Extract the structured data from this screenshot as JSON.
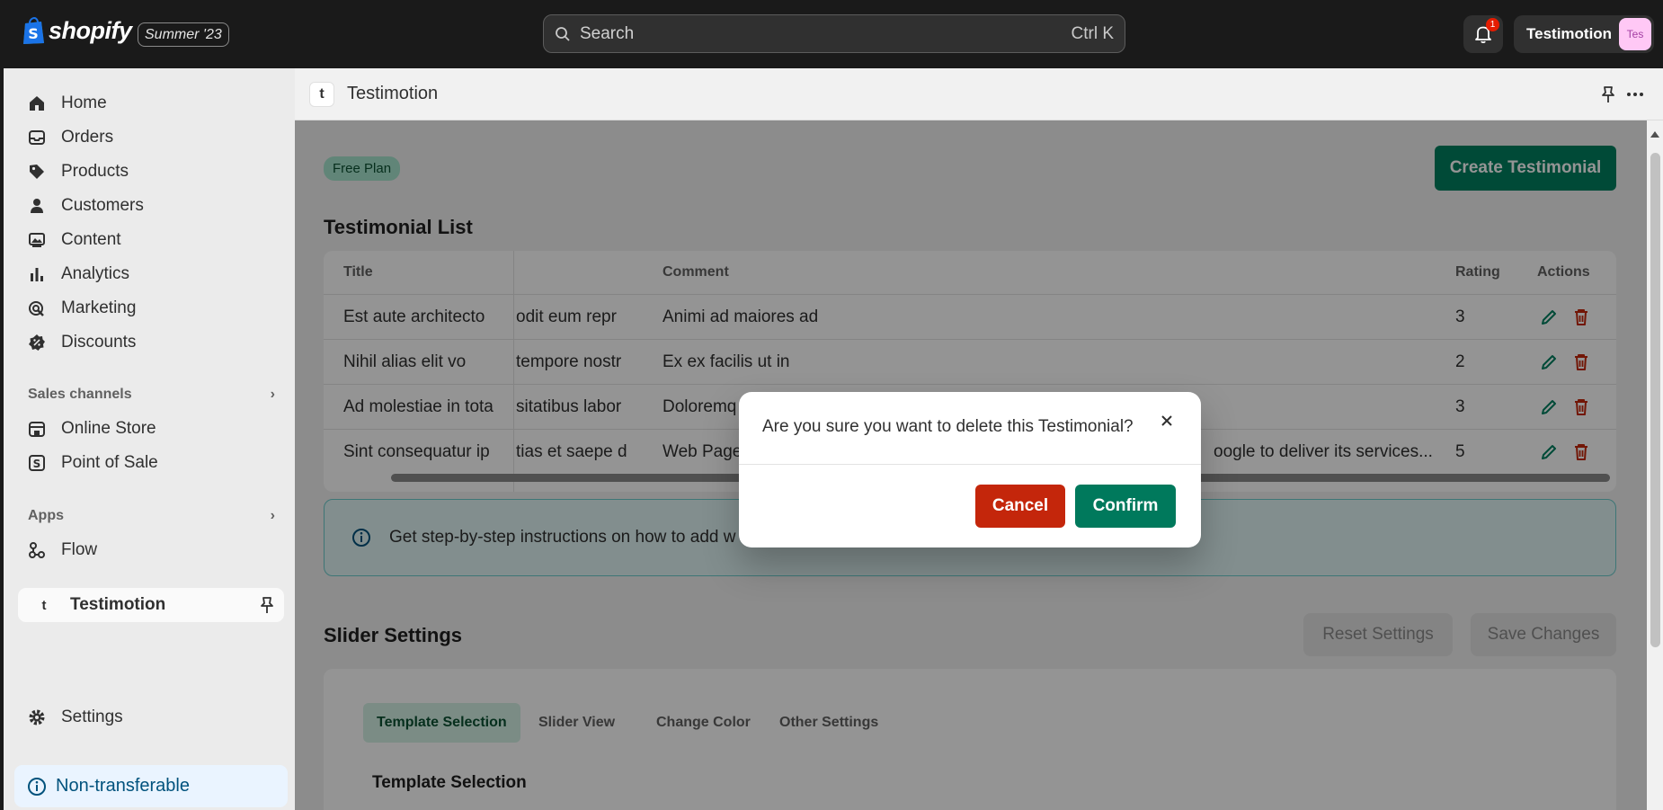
{
  "topbar": {
    "brand": "shopify",
    "edition": "Summer '23",
    "search_placeholder": "Search",
    "search_shortcut": "Ctrl K",
    "notification_count": "1",
    "store_name": "Testimotion",
    "store_avatar": "Tes"
  },
  "sidebar": {
    "items": [
      {
        "label": "Home",
        "icon": "home-icon"
      },
      {
        "label": "Orders",
        "icon": "inbox-icon"
      },
      {
        "label": "Products",
        "icon": "tag-icon"
      },
      {
        "label": "Customers",
        "icon": "person-icon"
      },
      {
        "label": "Content",
        "icon": "image-icon"
      },
      {
        "label": "Analytics",
        "icon": "bar-chart-icon"
      },
      {
        "label": "Marketing",
        "icon": "target-icon"
      },
      {
        "label": "Discounts",
        "icon": "discount-icon"
      }
    ],
    "sales_channels_heading": "Sales channels",
    "sales_channels": [
      {
        "label": "Online Store",
        "icon": "store-icon"
      },
      {
        "label": "Point of Sale",
        "icon": "pos-icon"
      }
    ],
    "apps_heading": "Apps",
    "apps": [
      {
        "label": "Flow",
        "icon": "flow-icon"
      }
    ],
    "active_app": "Testimotion",
    "active_app_glyph": "t",
    "settings_label": "Settings",
    "nontransferable_label": "Non-transferable"
  },
  "app_header": {
    "logo_glyph": "t",
    "name": "Testimotion"
  },
  "page": {
    "plan_badge": "Free Plan",
    "create_button": "Create Testimonial",
    "list_title": "Testimonial List",
    "table": {
      "headers": {
        "title": "Title",
        "comment": "Comment",
        "rating": "Rating",
        "actions": "Actions"
      },
      "rows": [
        {
          "title": "Est aute architecto",
          "second": "odit eum repr",
          "comment": "Animi ad maiores ad",
          "rating": "3"
        },
        {
          "title": "Nihil alias elit vo",
          "second": "tempore nostr",
          "comment": "Ex ex facilis ut in",
          "rating": "2"
        },
        {
          "title": "Ad molestiae in tota",
          "second": "sitatibus labor",
          "comment": "Doloremq",
          "rating": "3"
        },
        {
          "title": "Sint consequatur ip",
          "second": "tias et saepe d",
          "comment": "Web Page",
          "comment_tail": "oogle to deliver its services...",
          "rating": "5"
        }
      ]
    },
    "banner_text": "Get step-by-step instructions on how to add w",
    "slider_title": "Slider Settings",
    "reset_button": "Reset Settings",
    "save_button": "Save Changes",
    "tabs": [
      "Template Selection",
      "Slider View",
      "Change Color",
      "Other Settings"
    ],
    "template_heading": "Template Selection"
  },
  "modal": {
    "title": "Are you sure you want to delete this Testimonial?",
    "cancel": "Cancel",
    "confirm": "Confirm"
  },
  "colors": {
    "primary": "#008060",
    "danger": "#c4260b",
    "topbar": "#1a1a1a"
  }
}
